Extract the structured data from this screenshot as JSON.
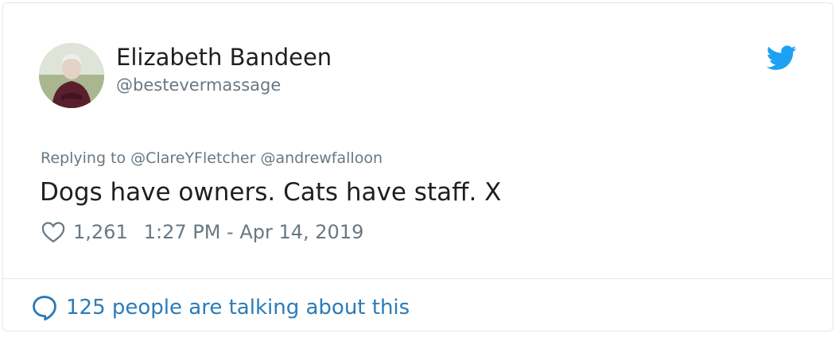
{
  "author": {
    "name": "Elizabeth Bandeen",
    "handle": "@bestevermassage"
  },
  "reply": {
    "prefix": "Replying to",
    "mentions": [
      "@ClareYFletcher",
      "@andrewfalloon"
    ]
  },
  "tweet": {
    "text": "Dogs have owners. Cats have staff. X",
    "likes": "1,261",
    "timestamp": "1:27 PM - Apr 14, 2019"
  },
  "footer": {
    "conversation_label": "125 people are talking about this"
  },
  "icons": {
    "brand": "twitter-bird-icon",
    "like": "heart-icon",
    "conversation": "speech-bubble-icon"
  },
  "colors": {
    "brand_blue": "#1da1f2",
    "link_blue": "#2b7bb9",
    "muted_gray": "#697882",
    "text_dark": "#1c2022",
    "border": "#e1e8ed"
  }
}
